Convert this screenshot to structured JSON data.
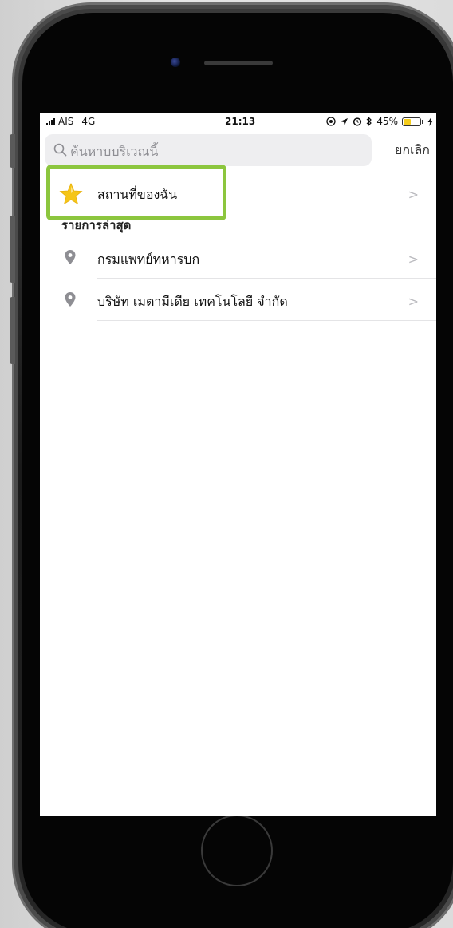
{
  "status_bar": {
    "carrier": "AIS",
    "network": "4G",
    "time": "21:13",
    "battery_percent": "45%",
    "battery_level": 0.45,
    "icons": [
      "signal-icon",
      "location-lock-icon",
      "location-arrow-icon",
      "alarm-icon",
      "bluetooth-icon",
      "battery-icon",
      "charging-icon"
    ]
  },
  "search": {
    "placeholder": "ค้นหาบบริเวณนี้",
    "cancel_label": "ยกเลิก"
  },
  "favorites": {
    "label": "สถานที่ของฉัน",
    "icon": "star-icon",
    "highlight_color": "#8cc63e"
  },
  "recents": {
    "header": "รายการล่าสุด",
    "items": [
      {
        "label": "กรมแพทย์ทหารบก",
        "icon": "map-pin-icon"
      },
      {
        "label": "บริษัท เมตามีเดีย เทคโนโลยี จํากัด",
        "icon": "map-pin-icon"
      }
    ]
  },
  "colors": {
    "accent_highlight": "#8cc63e",
    "star": "#f5c518",
    "pin": "#8e8e93",
    "battery": "#f5cd1b"
  }
}
